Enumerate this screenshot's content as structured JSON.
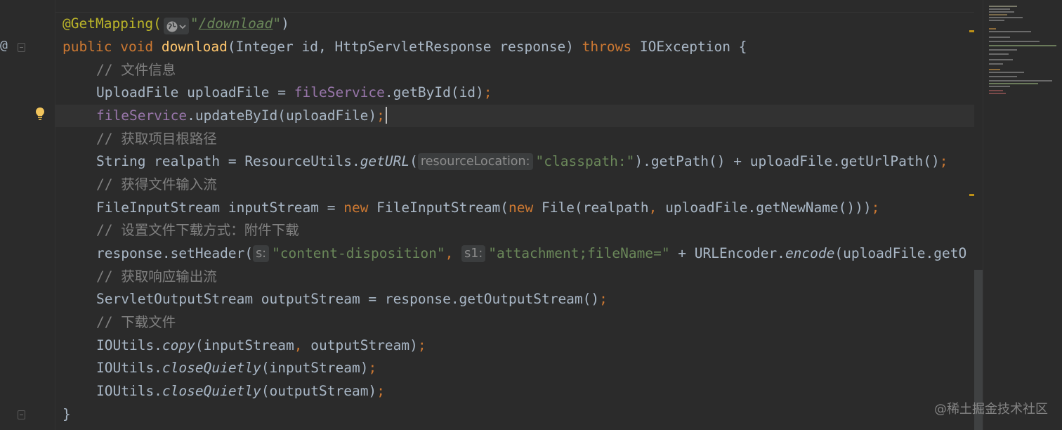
{
  "code_lines": [
    {
      "annotation": "@GetMapping(",
      "path": "/download",
      "close": ")"
    },
    {
      "kw_public": "public",
      "kw_void": "void",
      "method": "download",
      "params": "(Integer id, HttpServletResponse response) ",
      "kw_throws": "throws",
      "exception": " IOException {"
    },
    {
      "comment_prefix": "// ",
      "comment_text": "文件信息"
    },
    {
      "decl": "UploadFile uploadFile = ",
      "field": "fileService",
      "call": ".getById(id)",
      "semi": ";"
    },
    {
      "field": "fileService",
      "call": ".updateById(uploadFile)",
      "semi": ";"
    },
    {
      "comment_prefix": "// ",
      "comment_text": "获取项目根路径"
    },
    {
      "decl": "String realpath = ResourceUtils.",
      "static_call": "getURL",
      "open": "(",
      "hint": "resourceLocation:",
      "str": "\"classpath:\"",
      "rest": ").getPath() + uploadFile.getUrlPath()",
      "semi": ";"
    },
    {
      "comment_prefix": "// ",
      "comment_text": "获得文件输入流"
    },
    {
      "decl": "FileInputStream inputStream = ",
      "kw_new1": "new",
      "ctor1": " FileInputStream(",
      "kw_new2": "new",
      "ctor2": " File(realpath",
      "comma": ",",
      "rest": " uploadFile.getNewName()))",
      "semi": ";"
    },
    {
      "comment_prefix": "// ",
      "comment_text": "设置文件下载方式：附件下载"
    },
    {
      "decl": "response.setHeader(",
      "hint1": "s:",
      "str1": "\"content-disposition\"",
      "comma": ",",
      "hint2": "s1:",
      "str2": "\"attachment;fileName=\"",
      "rest": " + URLEncoder.",
      "static_call": "encode",
      "tail": "(uploadFile.getO"
    },
    {
      "comment_prefix": "// ",
      "comment_text": "获取响应输出流"
    },
    {
      "decl": "ServletOutputStream outputStream = response.getOutputStream()",
      "semi": ";"
    },
    {
      "comment_prefix": "// ",
      "comment_text": "下载文件"
    },
    {
      "cls": "IOUtils.",
      "static_call": "copy",
      "args": "(inputStream",
      "comma": ",",
      "args2": " outputStream)",
      "semi": ";"
    },
    {
      "cls": "IOUtils.",
      "static_call": "closeQuietly",
      "args": "(inputStream)",
      "semi": ";"
    },
    {
      "cls": "IOUtils.",
      "static_call": "closeQuietly",
      "args": "(outputStream)",
      "semi": ";"
    },
    {
      "brace": "}"
    }
  ],
  "gutter": {
    "override_marker": "@"
  },
  "icons": {
    "inlay_url": "globe-icon",
    "inlay_dropdown": "chevron-down-icon",
    "intention": "lightbulb-icon"
  },
  "watermark": "@稀土掘金技术社区",
  "colors": {
    "background": "#2b2b2b",
    "keyword": "#cc7832",
    "string": "#6a8759",
    "comment": "#808080",
    "method": "#ffc66d",
    "field": "#9876aa",
    "annotation": "#bbb529",
    "text": "#a9b7c6",
    "warning": "#be9117"
  }
}
